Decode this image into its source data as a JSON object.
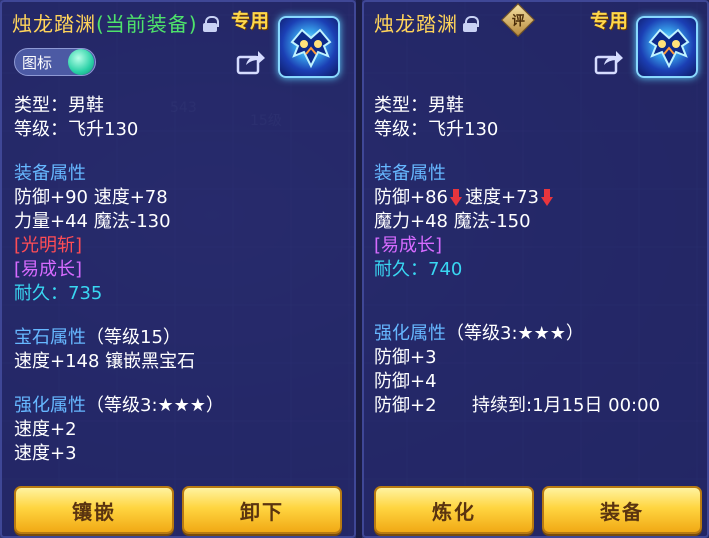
{
  "left": {
    "title": "烛龙踏渊",
    "current_tag": "(当前装备)",
    "exclusive": "专用",
    "toggle_label": "图标",
    "type_line": "类型：男鞋",
    "level_line": "等级：飞升130",
    "equip_attr_header": "装备属性",
    "attr_line1": "防御+90 速度+78",
    "attr_line2": "力量+44 魔法-130",
    "special1": "[光明斩]",
    "special2": "[易成长]",
    "durability_label": "耐久：",
    "durability_value": "735",
    "gem_header": "宝石属性",
    "gem_level": "（等级15）",
    "gem_line": "速度+148 镶嵌黑宝石",
    "enhance_header": "强化属性",
    "enhance_level": "（等级3:★★★）",
    "enhance_line1": "速度+2",
    "enhance_line2": "速度+3",
    "btn1": "镶嵌",
    "btn2": "卸下"
  },
  "right": {
    "title": "烛龙踏渊",
    "rate_label": "评",
    "exclusive": "专用",
    "type_line": "类型：男鞋",
    "level_line": "等级：飞升130",
    "equip_attr_header": "装备属性",
    "attr_def": "防御+86",
    "attr_spd": "速度+73",
    "attr_line2": "魔力+48 魔法-150",
    "special1": "[易成长]",
    "durability_label": "耐久：",
    "durability_value": "740",
    "enhance_header": "强化属性",
    "enhance_level": "（等级3:★★★）",
    "enhance_line1": "防御+3",
    "enhance_line2": "防御+4",
    "enhance_line3": "防御+2",
    "duration": "持续到:1月15日 00:00",
    "btn1": "炼化",
    "btn2": "装备"
  },
  "colors": {
    "gold_title": "#ffd45a",
    "current_green": "#4ee36b",
    "section_blue": "#66b7ff",
    "skill_red": "#ff4d55",
    "skill_magenta": "#d66bff",
    "durability_cyan": "#39d7f2",
    "button_gold": "#ffd540"
  },
  "icons": [
    "lock-icon",
    "share-icon",
    "toggle-knob",
    "item-boots-icon",
    "rate-badge",
    "down-arrow-icon"
  ]
}
